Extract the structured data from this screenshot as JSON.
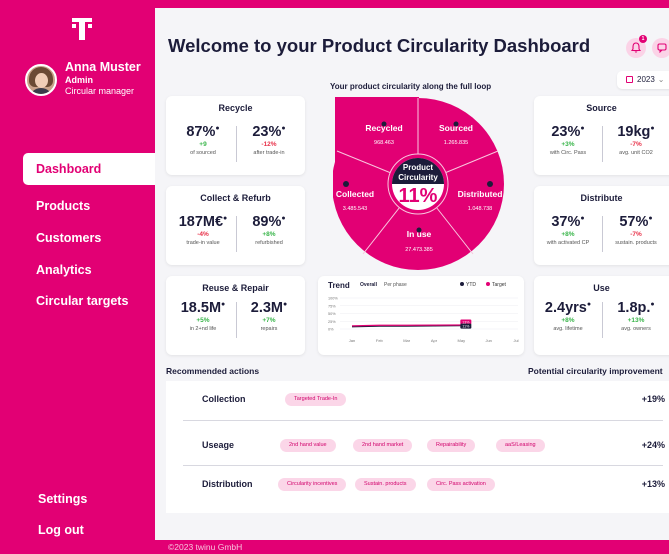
{
  "sidebar": {
    "user_name": "Anna Muster",
    "user_role": "Admin",
    "user_title": "Circular manager",
    "nav": [
      "Dashboard",
      "Products",
      "Customers",
      "Analytics",
      "Circular targets"
    ],
    "settings": "Settings",
    "logout": "Log out"
  },
  "header": {
    "title": "Welcome to your Product Circularity Dashboard",
    "notif_count": "1",
    "year": "2023"
  },
  "colors": {
    "brand": "#e20074",
    "positive": "#39b54a",
    "negative": "#e8324a"
  },
  "cards": {
    "recycle": {
      "title": "Recycle",
      "m1": {
        "value": "87%",
        "delta": "+9",
        "label": "of sourced"
      },
      "m2": {
        "value": "23%",
        "delta": "-12%",
        "label": "after trade-in"
      }
    },
    "collect": {
      "title": "Collect & Refurb",
      "m1": {
        "value": "187M€",
        "delta": "-4%",
        "label": "trade-in value"
      },
      "m2": {
        "value": "89%",
        "delta": "+8%",
        "label": "refurbished"
      }
    },
    "reuse": {
      "title": "Reuse & Repair",
      "m1": {
        "value": "18.5M",
        "delta": "+5%",
        "label": "in 2+nd life"
      },
      "m2": {
        "value": "2.3M",
        "delta": "+7%",
        "label": "repairs"
      }
    },
    "source": {
      "title": "Source",
      "m1": {
        "value": "23%",
        "delta": "+3%",
        "label": "with Circ. Pass"
      },
      "m2": {
        "value": "19kg",
        "delta": "-7%",
        "label": "avg. unit CO2"
      }
    },
    "distribute": {
      "title": "Distribute",
      "m1": {
        "value": "37%",
        "delta": "+8%",
        "label": "with activated CP"
      },
      "m2": {
        "value": "57%",
        "delta": "-7%",
        "label": "sustain. products"
      }
    },
    "use": {
      "title": "Use",
      "m1": {
        "value": "2.4yrs",
        "delta": "+8%",
        "label": "avg. lifetime"
      },
      "m2": {
        "value": "1.8p.",
        "delta": "+13%",
        "label": "avg. owners"
      }
    }
  },
  "loop": {
    "title": "Your product circularity along the full loop",
    "center_label": "Product Circularity",
    "center_value": "11%",
    "segments": [
      {
        "name": "Recycled",
        "value": "968.463"
      },
      {
        "name": "Sourced",
        "value": "1.265.835"
      },
      {
        "name": "Distributed",
        "value": "1.048.738"
      },
      {
        "name": "In use",
        "value": "27.473.385"
      },
      {
        "name": "Collected",
        "value": "3.485.543"
      }
    ]
  },
  "trend": {
    "title": "Trend",
    "tabs": [
      "Overall",
      "Per phase"
    ],
    "legend": [
      "YTD",
      "Target"
    ],
    "y_ticks": [
      "100%",
      "75%",
      "50%",
      "25%",
      "0%"
    ],
    "months": [
      "Jan",
      "Feb",
      "Mar",
      "Apr",
      "May",
      "Jun",
      "Jul"
    ],
    "marker_high": "13%",
    "marker_low": "11%"
  },
  "chart_data": {
    "type": "line",
    "title": "Trend",
    "x": [
      "Jan",
      "Feb",
      "Mar",
      "Apr",
      "May"
    ],
    "series": [
      {
        "name": "YTD",
        "values": [
          7,
          9,
          9,
          10,
          11
        ]
      },
      {
        "name": "Target",
        "values": [
          10,
          12,
          12,
          12.5,
          13
        ]
      }
    ],
    "ylim": [
      0,
      100
    ]
  },
  "recommended": {
    "header": "Recommended actions",
    "potential_header": "Potential circularity improvement",
    "rows": [
      {
        "label": "Collection",
        "chips": [
          "Targeted Trade-In"
        ],
        "pct": "+19%"
      },
      {
        "label": "Useage",
        "chips": [
          "2nd hand value",
          "2nd hand market",
          "Repairability",
          "aaS/Leasing"
        ],
        "pct": "+24%"
      },
      {
        "label": "Distribution",
        "chips": [
          "Circularity incentives",
          "Sustain. products",
          "Circ. Pass activation"
        ],
        "pct": "+13%"
      }
    ]
  },
  "footer": "©2023 twinu GmbH"
}
